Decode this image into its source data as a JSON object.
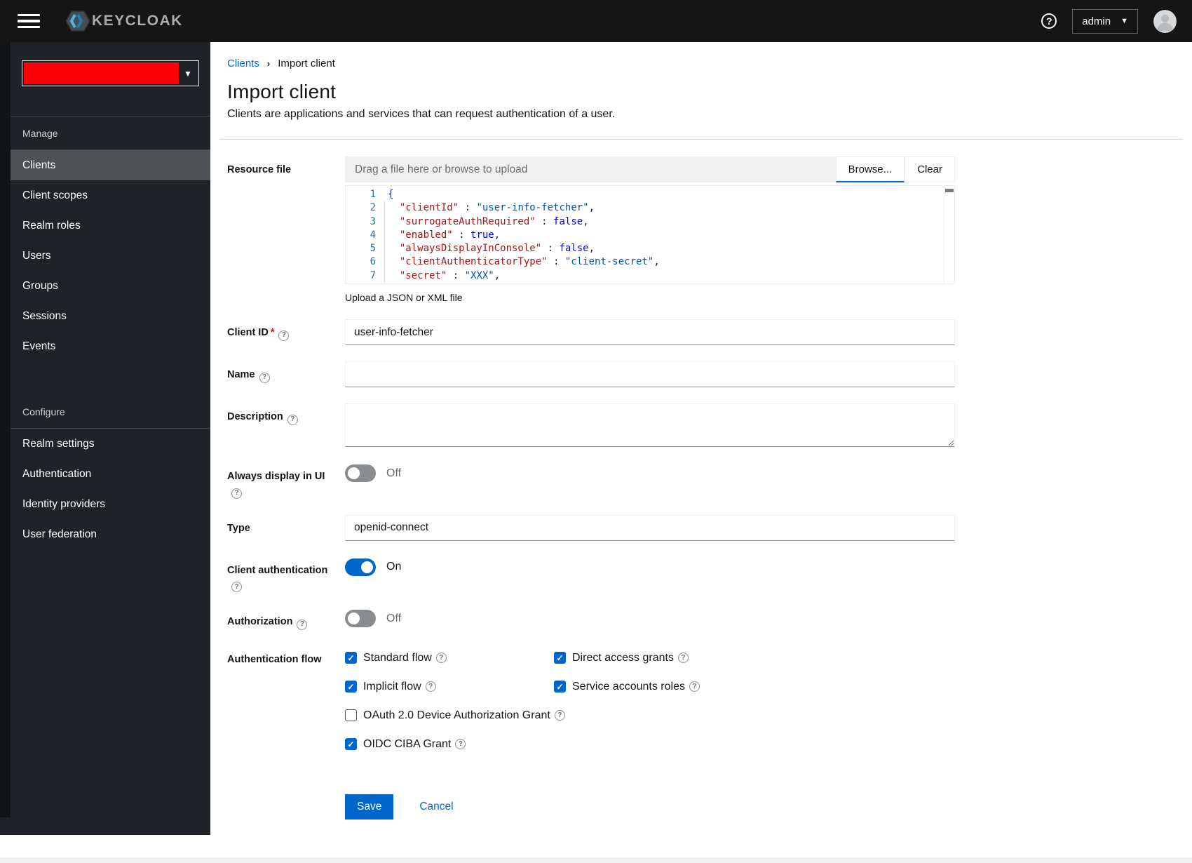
{
  "topbar": {
    "brand": "KEYCLOAK",
    "help": "?",
    "user": "admin"
  },
  "sidebar": {
    "manage": {
      "title": "Manage",
      "items": [
        {
          "label": "Clients",
          "selected": true
        },
        {
          "label": "Client scopes"
        },
        {
          "label": "Realm roles"
        },
        {
          "label": "Users"
        },
        {
          "label": "Groups"
        },
        {
          "label": "Sessions"
        },
        {
          "label": "Events"
        }
      ]
    },
    "configure": {
      "title": "Configure",
      "items": [
        {
          "label": "Realm settings"
        },
        {
          "label": "Authentication"
        },
        {
          "label": "Identity providers"
        },
        {
          "label": "User federation"
        }
      ]
    }
  },
  "header": {
    "breadcrumb": [
      "Clients",
      "Import client"
    ],
    "title": "Import client",
    "subtitle": "Clients are applications and services that can request authentication of a user."
  },
  "form": {
    "resource_file": {
      "label": "Resource file",
      "placeholder": "Drag a file here or browse to upload",
      "browse": "Browse...",
      "clear": "Clear",
      "helper": "Upload a JSON or XML file"
    },
    "editor": {
      "lines": [
        {
          "num": "1",
          "guide": false,
          "tokens": [
            {
              "c": "brace",
              "t": "{"
            }
          ]
        },
        {
          "num": "2",
          "guide": true,
          "tokens": [
            {
              "c": "plain",
              "t": "  "
            },
            {
              "c": "key",
              "t": "\"clientId\""
            },
            {
              "c": "plain",
              "t": " : "
            },
            {
              "c": "str",
              "t": "\"user-info-fetcher\""
            },
            {
              "c": "plain",
              "t": ","
            }
          ]
        },
        {
          "num": "3",
          "guide": true,
          "tokens": [
            {
              "c": "plain",
              "t": "  "
            },
            {
              "c": "key",
              "t": "\"surrogateAuthRequired\""
            },
            {
              "c": "plain",
              "t": " : "
            },
            {
              "c": "bool",
              "t": "false"
            },
            {
              "c": "plain",
              "t": ","
            }
          ]
        },
        {
          "num": "4",
          "guide": true,
          "tokens": [
            {
              "c": "plain",
              "t": "  "
            },
            {
              "c": "key",
              "t": "\"enabled\""
            },
            {
              "c": "plain",
              "t": " : "
            },
            {
              "c": "bool",
              "t": "true"
            },
            {
              "c": "plain",
              "t": ","
            }
          ]
        },
        {
          "num": "5",
          "guide": true,
          "tokens": [
            {
              "c": "plain",
              "t": "  "
            },
            {
              "c": "key",
              "t": "\"alwaysDisplayInConsole\""
            },
            {
              "c": "plain",
              "t": " : "
            },
            {
              "c": "bool",
              "t": "false"
            },
            {
              "c": "plain",
              "t": ","
            }
          ]
        },
        {
          "num": "6",
          "guide": true,
          "tokens": [
            {
              "c": "plain",
              "t": "  "
            },
            {
              "c": "key",
              "t": "\"clientAuthenticatorType\""
            },
            {
              "c": "plain",
              "t": " : "
            },
            {
              "c": "str",
              "t": "\"client-secret\""
            },
            {
              "c": "plain",
              "t": ","
            }
          ]
        },
        {
          "num": "7",
          "guide": true,
          "tokens": [
            {
              "c": "plain",
              "t": "  "
            },
            {
              "c": "key",
              "t": "\"secret\""
            },
            {
              "c": "plain",
              "t": " : "
            },
            {
              "c": "str",
              "t": "\"XXX\""
            },
            {
              "c": "plain",
              "t": ","
            }
          ]
        }
      ]
    },
    "client_id": {
      "label": "Client ID",
      "required": "*",
      "value": "user-info-fetcher"
    },
    "name": {
      "label": "Name",
      "value": ""
    },
    "description": {
      "label": "Description",
      "value": ""
    },
    "always_display": {
      "label": "Always display in UI",
      "state": "Off"
    },
    "type": {
      "label": "Type",
      "value": "openid-connect"
    },
    "client_auth": {
      "label": "Client authentication",
      "state": "On"
    },
    "authorization": {
      "label": "Authorization",
      "state": "Off"
    },
    "auth_flow": {
      "label": "Authentication flow",
      "options": [
        {
          "label": "Standard flow",
          "checked": true
        },
        {
          "label": "Direct access grants",
          "checked": true
        },
        {
          "label": "Implicit flow",
          "checked": true
        },
        {
          "label": "Service accounts roles",
          "checked": true
        },
        {
          "label": "OAuth 2.0 Device Authorization Grant",
          "checked": false,
          "wide": true
        },
        {
          "label": "OIDC CIBA Grant",
          "checked": true
        }
      ]
    },
    "actions": {
      "save": "Save",
      "cancel": "Cancel"
    }
  },
  "colors": {
    "accent": "#0066cc",
    "masthead": "#151515",
    "sidebar": "#1f2226",
    "nav_selected_indicator": "#2b9af3",
    "required": "#c9190b",
    "redaction": "#fb0007",
    "code_key": "#a31515",
    "code_string": "#0451a5",
    "code_bool": "#0000ff",
    "code_linenum": "#237893"
  }
}
